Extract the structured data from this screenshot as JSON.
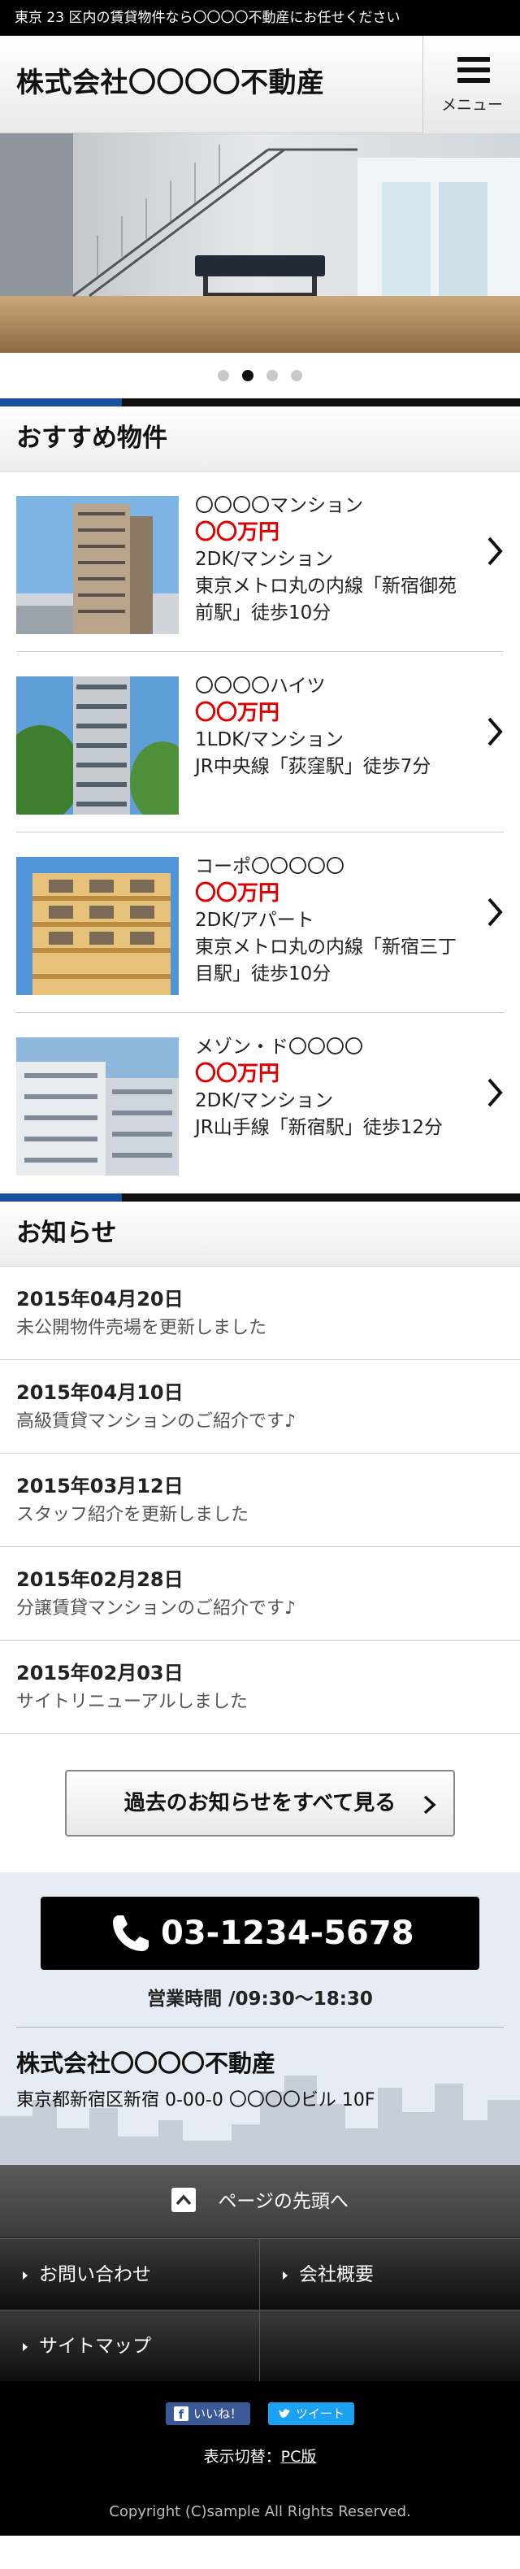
{
  "topbar": {
    "text": "東京 23 区内の賃貸物件なら〇〇〇〇不動産にお任せください"
  },
  "header": {
    "logo": "株式会社〇〇〇〇不動産",
    "menu_label": "メニュー"
  },
  "hero": {
    "slide_count": 4,
    "active_slide": 2
  },
  "recommended": {
    "title": "おすすめ物件",
    "items": [
      {
        "name": "〇〇〇〇マンション",
        "price": "〇〇万円",
        "type": "2DK/マンション",
        "access": "東京メトロ丸の内線「新宿御苑前駅」徒歩10分"
      },
      {
        "name": "〇〇〇〇ハイツ",
        "price": "〇〇万円",
        "type": "1LDK/マンション",
        "access": "JR中央線「荻窪駅」徒歩7分"
      },
      {
        "name": "コーポ〇〇〇〇〇",
        "price": "〇〇万円",
        "type": "2DK/アパート",
        "access": "東京メトロ丸の内線「新宿三丁目駅」徒歩10分"
      },
      {
        "name": "メゾン・ド〇〇〇〇",
        "price": "〇〇万円",
        "type": "2DK/マンション",
        "access": "JR山手線「新宿駅」徒歩12分"
      }
    ]
  },
  "news": {
    "title": "お知らせ",
    "items": [
      {
        "date": "2015年04月20日",
        "text": "未公開物件売場を更新しました"
      },
      {
        "date": "2015年04月10日",
        "text": "高級賃貸マンションのご紹介です♪"
      },
      {
        "date": "2015年03月12日",
        "text": "スタッフ紹介を更新しました"
      },
      {
        "date": "2015年02月28日",
        "text": "分譲賃貸マンションのご紹介です♪"
      },
      {
        "date": "2015年02月03日",
        "text": "サイトリニューアルしました"
      }
    ],
    "more_label": "過去のお知らせをすべて見る"
  },
  "contact": {
    "phone": "03-1234-5678",
    "hours": "営業時間 /09:30～18:30",
    "company": "株式会社〇〇〇〇不動産",
    "address": "東京都新宿区新宿 0-00-0 〇〇〇〇ビル 10F"
  },
  "footer": {
    "pagetop_label": "ページの先頭へ",
    "nav": [
      "お問い合わせ",
      "会社概要",
      "サイトマップ"
    ],
    "fb_label": "いいね！",
    "tw_label": "ツイート",
    "switch_label": "表示切替：",
    "switch_link": "PC版",
    "copyright": "Copyright (C)sample All Rights Reserved."
  },
  "colors": {
    "accent_blue": "#1a4f9c",
    "price_red": "#e00000",
    "facebook": "#3b5998",
    "twitter": "#1da1f2"
  },
  "icons": [
    "hamburger-icon",
    "chevron-right-icon",
    "phone-icon",
    "arrow-up-icon",
    "facebook-icon",
    "twitter-icon"
  ]
}
